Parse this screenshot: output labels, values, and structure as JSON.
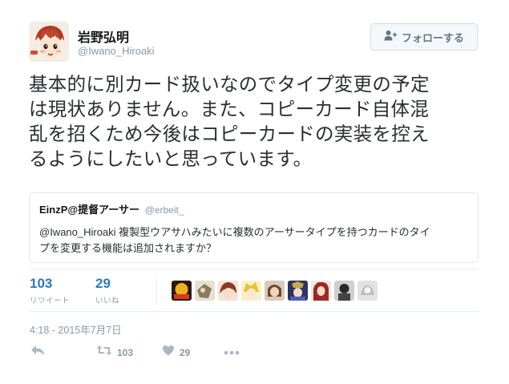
{
  "user": {
    "display_name": "岩野弘明",
    "handle": "@Iwano_Hiroaki"
  },
  "follow_button": {
    "label": "フォローする"
  },
  "tweet": {
    "lines": [
      "基本的に別カード扱いなのでタイプ変更の予定",
      "は現状ありません。また、コピーカード自体混",
      "乱を招くため今後はコピーカードの実装を控え",
      "るようにしたいと思っています。"
    ]
  },
  "quoted_tweet": {
    "name": "EinzP@提督アーサー",
    "handle": "@erbeit_",
    "lines": [
      "@Iwano_Hiroaki 複製型ウアサハみたいに複数のアーサータイプを持つカードのタイ",
      "プを変更する機能は追加されますか？"
    ]
  },
  "stats": {
    "retweets": {
      "count": "103",
      "label": "リツイート"
    },
    "likes": {
      "count": "29",
      "label": "いいね"
    }
  },
  "timestamp": "4:18 - 2015年7月7日",
  "actions": {
    "retweet_count": "103",
    "like_count": "29"
  },
  "colors": {
    "link": "#2b7bb9",
    "muted": "#8899a6",
    "text": "#292f33",
    "border": "#e1e8ed"
  },
  "icons": [
    "follow-person-icon",
    "reply-icon",
    "retweet-icon",
    "heart-icon",
    "more-icon"
  ]
}
